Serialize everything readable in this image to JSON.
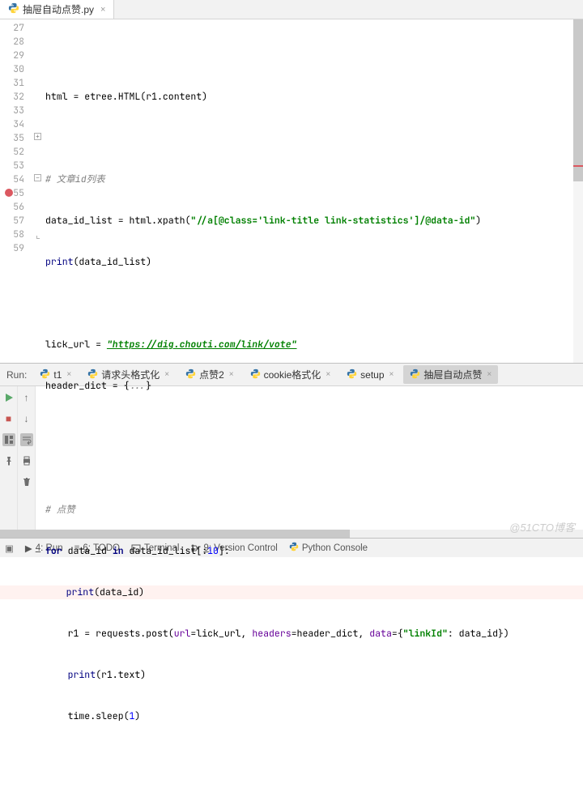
{
  "editor_tab": {
    "label": "抽屉自动点赞.py"
  },
  "gutter": {
    "start": 27,
    "end": 59,
    "breakpoint_line": 55
  },
  "folds": [
    {
      "line": 35,
      "state": "+"
    },
    {
      "line": 54,
      "state": "-"
    },
    {
      "line": 58,
      "state": "end"
    }
  ],
  "code": {
    "l28_a": "html = etree.HTML(r1.content)",
    "l30_cmt": "# 文章id列表",
    "l31_a": "data_id_list = html.xpath(",
    "l31_str": "\"//a[@class='link-title link-statistics']/@data-id\"",
    "l31_b": ")",
    "l32_a": "(data_id_list)",
    "l34_a": "lick_url = ",
    "l34_url": "\"https://dig.chouti.com/link/vote\"",
    "l35_a": "header_dict = {",
    "l35_fold": "...",
    "l35_b": "}",
    "l53_cmt": "# 点赞",
    "l54_for": "for",
    "l54_a": " data_id ",
    "l54_in": "in",
    "l54_b": " data_id_list[:",
    "l54_n": "10",
    "l54_c": "]:",
    "l55_a": "(data_id)",
    "l56_a": "r1 = requests.post(",
    "l56_p1": "url",
    "l56_b": "=lick_url, ",
    "l56_p2": "headers",
    "l56_c": "=header_dict, ",
    "l56_p3": "data",
    "l56_d": "={",
    "l56_str": "\"linkId\"",
    "l56_e": ": data_id})",
    "l57_a": "(r1.text)",
    "l58_a": "time.sleep(",
    "l58_n": "1",
    "l58_b": ")",
    "print": "print"
  },
  "run": {
    "label": "Run:",
    "tabs": [
      {
        "label": "t1"
      },
      {
        "label": "请求头格式化"
      },
      {
        "label": "点赞2"
      },
      {
        "label": "cookie格式化"
      },
      {
        "label": "setup"
      },
      {
        "label": "抽屉自动点赞",
        "active": true
      }
    ]
  },
  "status": {
    "run": "4: Run",
    "todo": "6: TODO",
    "terminal": "Terminal",
    "vcs": "9: Version Control",
    "pyconsole": "Python Console"
  },
  "watermark": "@51CTO博客"
}
